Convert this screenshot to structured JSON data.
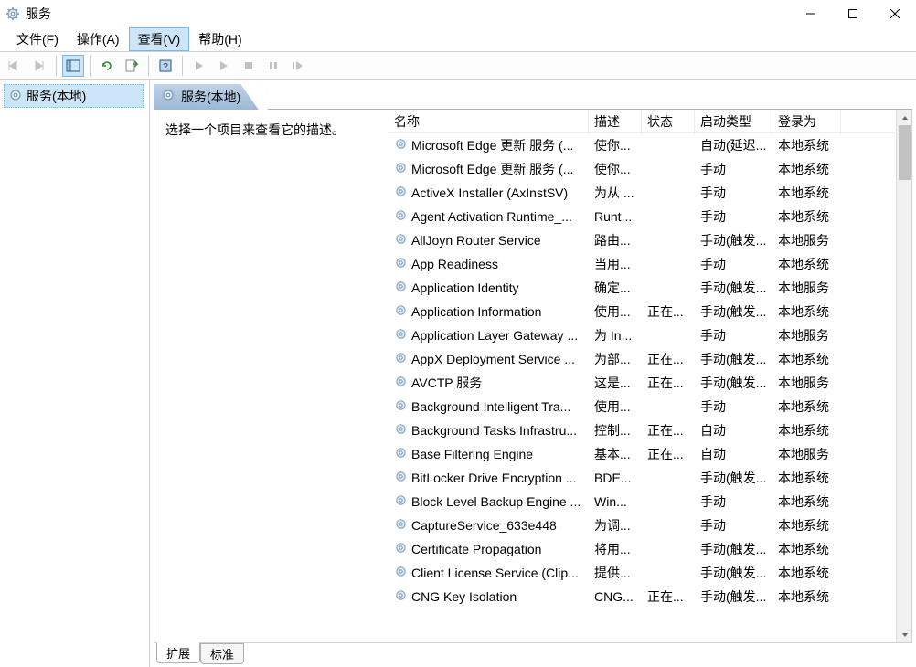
{
  "window": {
    "title": "服务"
  },
  "menu": {
    "file": "文件(F)",
    "action": "操作(A)",
    "view": "查看(V)",
    "help": "帮助(H)"
  },
  "tree": {
    "root_label": "服务(本地)"
  },
  "panel_header": {
    "label": "服务(本地)"
  },
  "desc_panel": {
    "hint": "选择一个项目来查看它的描述。"
  },
  "columns": {
    "name": "名称",
    "description": "描述",
    "state": "状态",
    "startup": "启动类型",
    "logon": "登录为"
  },
  "tabs": {
    "extended": "扩展",
    "standard": "标准"
  },
  "services": [
    {
      "name": "Microsoft Edge 更新 服务 (...",
      "desc": "使你...",
      "state": "",
      "startup": "自动(延迟...",
      "logon": "本地系统"
    },
    {
      "name": "Microsoft Edge 更新 服务 (...",
      "desc": "使你...",
      "state": "",
      "startup": "手动",
      "logon": "本地系统"
    },
    {
      "name": "ActiveX Installer (AxInstSV)",
      "desc": "为从 ...",
      "state": "",
      "startup": "手动",
      "logon": "本地系统"
    },
    {
      "name": "Agent Activation Runtime_...",
      "desc": "Runt...",
      "state": "",
      "startup": "手动",
      "logon": "本地系统"
    },
    {
      "name": "AllJoyn Router Service",
      "desc": "路由...",
      "state": "",
      "startup": "手动(触发...",
      "logon": "本地服务"
    },
    {
      "name": "App Readiness",
      "desc": "当用...",
      "state": "",
      "startup": "手动",
      "logon": "本地系统"
    },
    {
      "name": "Application Identity",
      "desc": "确定...",
      "state": "",
      "startup": "手动(触发...",
      "logon": "本地服务"
    },
    {
      "name": "Application Information",
      "desc": "使用...",
      "state": "正在...",
      "startup": "手动(触发...",
      "logon": "本地系统"
    },
    {
      "name": "Application Layer Gateway ...",
      "desc": "为 In...",
      "state": "",
      "startup": "手动",
      "logon": "本地服务"
    },
    {
      "name": "AppX Deployment Service ...",
      "desc": "为部...",
      "state": "正在...",
      "startup": "手动(触发...",
      "logon": "本地系统"
    },
    {
      "name": "AVCTP 服务",
      "desc": "这是...",
      "state": "正在...",
      "startup": "手动(触发...",
      "logon": "本地服务"
    },
    {
      "name": "Background Intelligent Tra...",
      "desc": "使用...",
      "state": "",
      "startup": "手动",
      "logon": "本地系统"
    },
    {
      "name": "Background Tasks Infrastru...",
      "desc": "控制...",
      "state": "正在...",
      "startup": "自动",
      "logon": "本地系统"
    },
    {
      "name": "Base Filtering Engine",
      "desc": "基本...",
      "state": "正在...",
      "startup": "自动",
      "logon": "本地服务"
    },
    {
      "name": "BitLocker Drive Encryption ...",
      "desc": "BDE...",
      "state": "",
      "startup": "手动(触发...",
      "logon": "本地系统"
    },
    {
      "name": "Block Level Backup Engine ...",
      "desc": "Win...",
      "state": "",
      "startup": "手动",
      "logon": "本地系统"
    },
    {
      "name": "CaptureService_633e448",
      "desc": "为调...",
      "state": "",
      "startup": "手动",
      "logon": "本地系统"
    },
    {
      "name": "Certificate Propagation",
      "desc": "将用...",
      "state": "",
      "startup": "手动(触发...",
      "logon": "本地系统"
    },
    {
      "name": "Client License Service (Clip...",
      "desc": "提供...",
      "state": "",
      "startup": "手动(触发...",
      "logon": "本地系统"
    },
    {
      "name": "CNG Key Isolation",
      "desc": "CNG...",
      "state": "正在...",
      "startup": "手动(触发...",
      "logon": "本地系统"
    }
  ]
}
